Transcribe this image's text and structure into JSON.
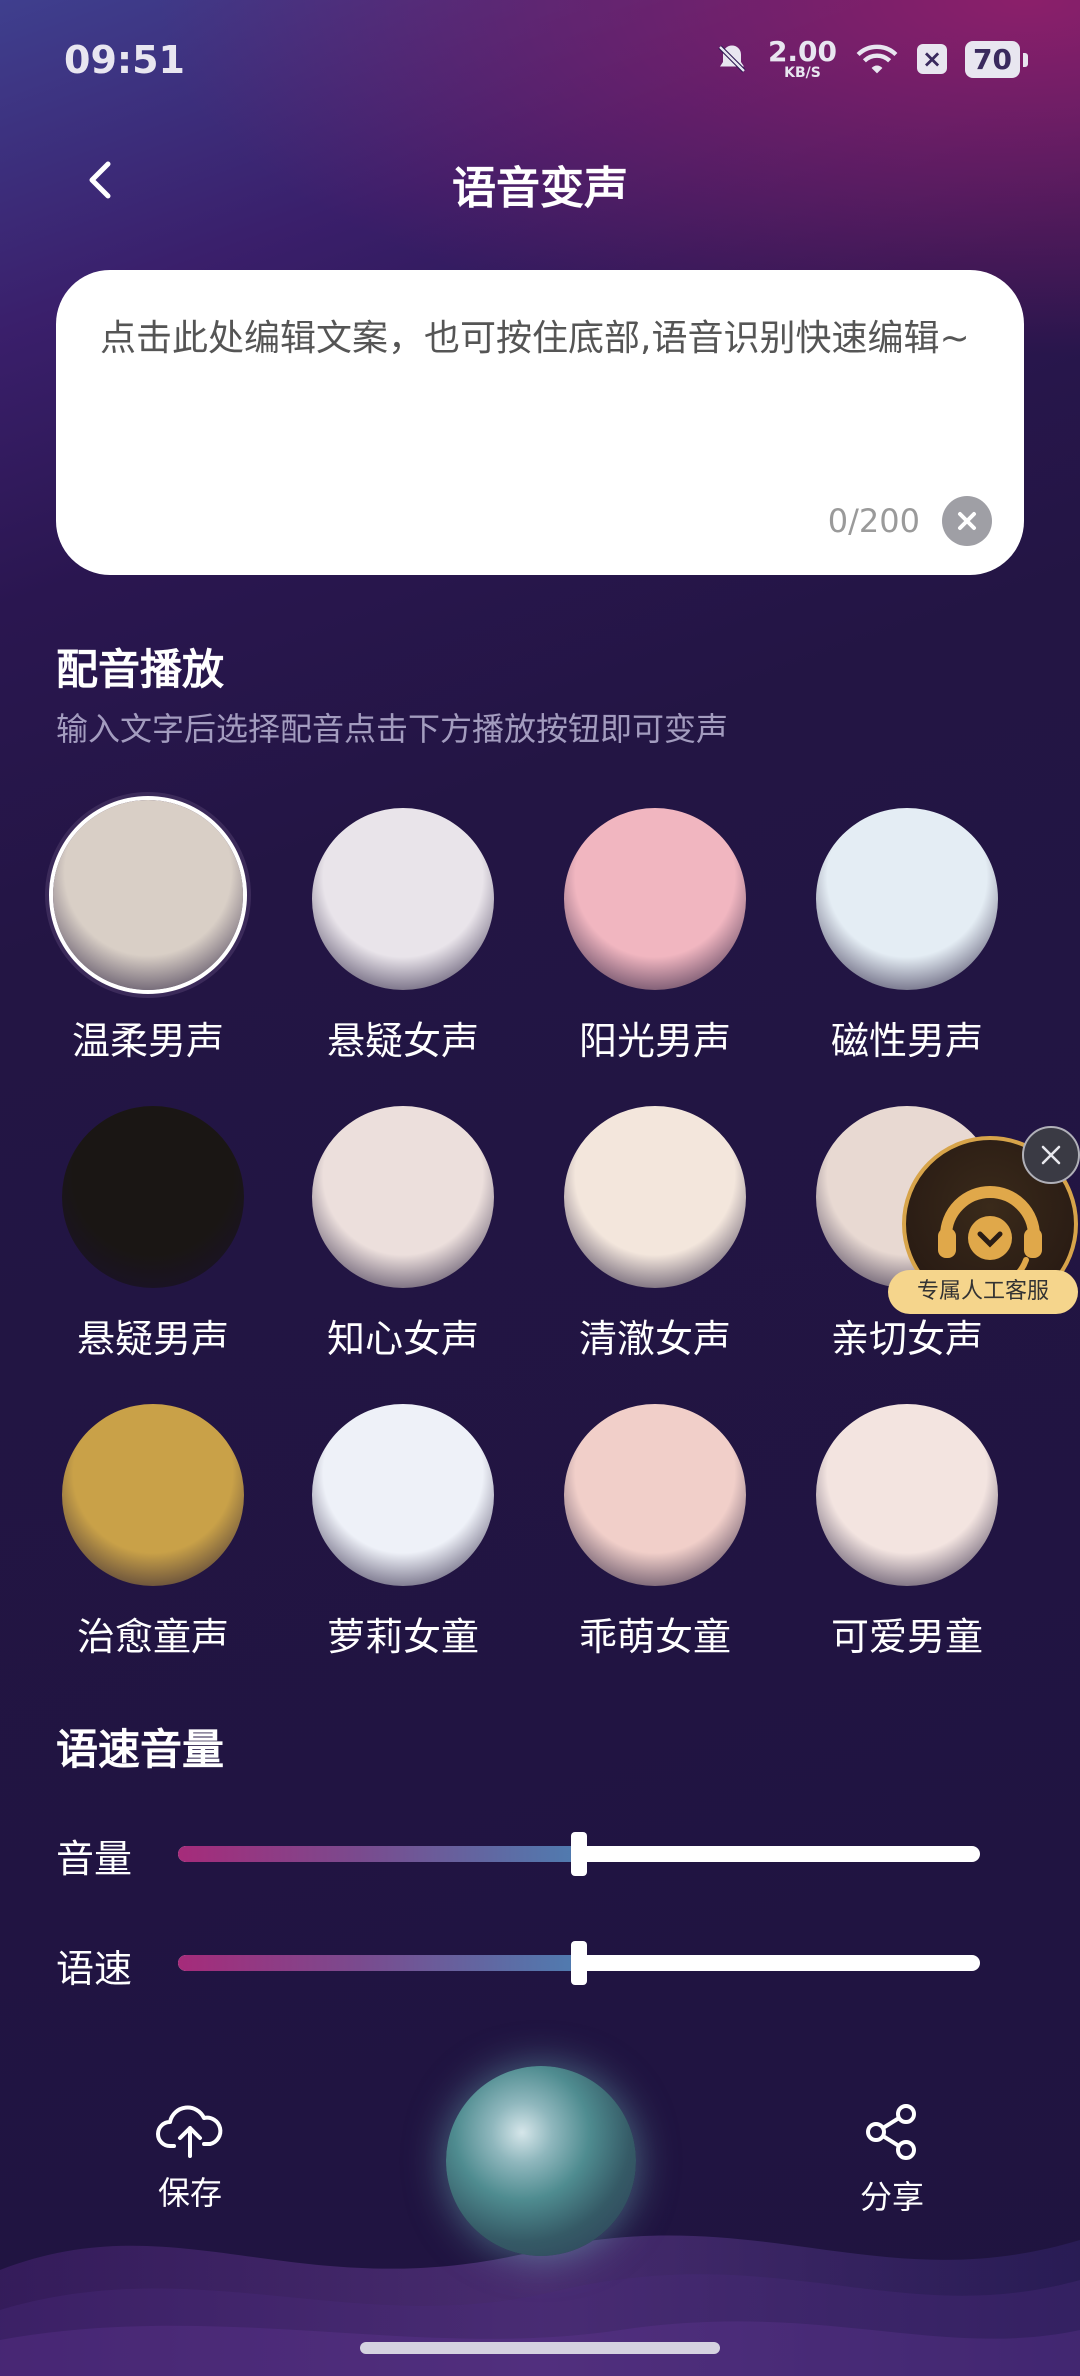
{
  "status_bar": {
    "time": "09:51",
    "speed_value": "2.00",
    "speed_unit": "KB/S",
    "battery": "70"
  },
  "header": {
    "title": "语音变声"
  },
  "text_card": {
    "placeholder": "点击此处编辑文案，也可按住底部,语音识别快速编辑~",
    "counter": "0/200"
  },
  "dubbing": {
    "title": "配音播放",
    "subtitle": "输入文字后选择配音点击下方播放按钮即可变声",
    "voices": [
      {
        "label": "温柔男声",
        "color": "#d9cfc6",
        "selected": true
      },
      {
        "label": "悬疑女声",
        "color": "#e9e4ea"
      },
      {
        "label": "阳光男声",
        "color": "#f1b6c0"
      },
      {
        "label": "磁性男声",
        "color": "#e4edf4"
      },
      {
        "label": "悬疑男声",
        "color": "#1a1614"
      },
      {
        "label": "知心女声",
        "color": "#ecdfdc"
      },
      {
        "label": "清澈女声",
        "color": "#f3e6dc"
      },
      {
        "label": "亲切女声",
        "color": "#e8d9d2"
      },
      {
        "label": "治愈童声",
        "color": "#c9a148"
      },
      {
        "label": "萝莉女童",
        "color": "#eef1f8"
      },
      {
        "label": "乖萌女童",
        "color": "#f1cfc9"
      },
      {
        "label": "可爱男童",
        "color": "#f3e4e0"
      }
    ]
  },
  "service": {
    "label": "专属人工客服"
  },
  "speed_volume": {
    "title": "语速音量",
    "volume_label": "音量",
    "volume_level": 0.5,
    "speed_label": "语速",
    "speed_level": 0.5
  },
  "bottom": {
    "save_label": "保存",
    "share_label": "分享"
  }
}
